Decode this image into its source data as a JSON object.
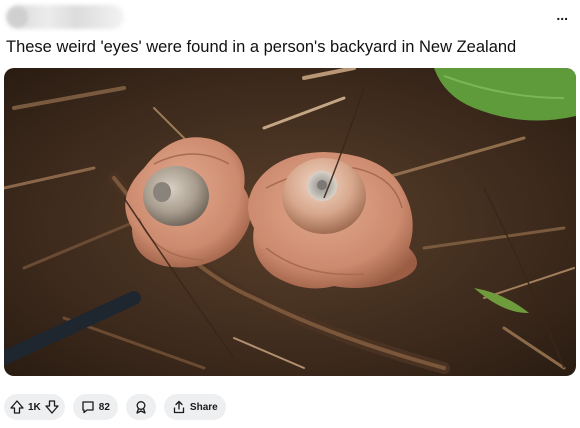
{
  "post": {
    "title": "These weird 'eyes' were found in a person's backyard in New Zealand",
    "more_icon": "..."
  },
  "actions": {
    "vote_count": "1K",
    "comment_count": "82",
    "share_label": "Share"
  }
}
